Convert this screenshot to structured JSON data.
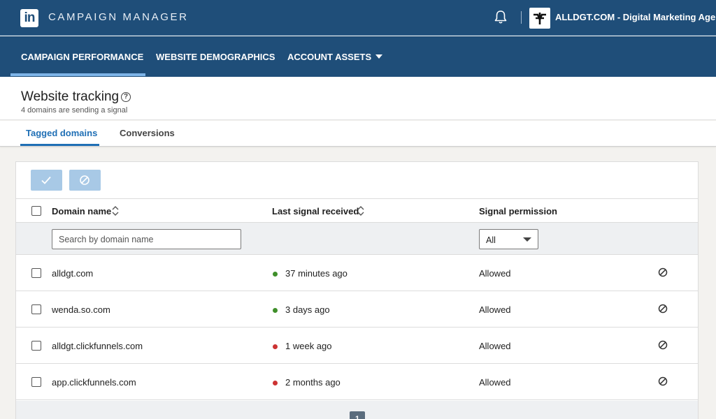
{
  "header": {
    "logo_text": "in",
    "app_title": "CAMPAIGN MANAGER",
    "account_name": "ALLDGT.COM - Digital Marketing Agency"
  },
  "nav": {
    "items": [
      {
        "label": "CAMPAIGN PERFORMANCE",
        "active": true
      },
      {
        "label": "WEBSITE DEMOGRAPHICS",
        "active": false
      },
      {
        "label": "ACCOUNT ASSETS",
        "active": false
      }
    ]
  },
  "page": {
    "title": "Website tracking",
    "help_glyph": "?",
    "subtitle": "4 domains are sending a signal"
  },
  "tabs": [
    {
      "label": "Tagged domains",
      "active": true
    },
    {
      "label": "Conversions",
      "active": false
    }
  ],
  "table": {
    "columns": {
      "domain": "Domain name",
      "last_signal": "Last signal received",
      "permission": "Signal permission"
    },
    "search_placeholder": "Search by domain name",
    "permission_filter": "All",
    "rows": [
      {
        "domain": "alldgt.com",
        "last_signal": "37 minutes ago",
        "status": "green",
        "permission": "Allowed"
      },
      {
        "domain": "wenda.so.com",
        "last_signal": "3 days ago",
        "status": "green",
        "permission": "Allowed"
      },
      {
        "domain": "alldgt.clickfunnels.com",
        "last_signal": "1 week ago",
        "status": "red",
        "permission": "Allowed"
      },
      {
        "domain": "app.clickfunnels.com",
        "last_signal": "2 months ago",
        "status": "red",
        "permission": "Allowed"
      }
    ],
    "pagination": {
      "current_page": "1"
    }
  },
  "colors": {
    "header_bg": "#1f4e79",
    "accent": "#1f6fb5",
    "status_green": "#3f8f2a",
    "status_red": "#cc3333"
  }
}
